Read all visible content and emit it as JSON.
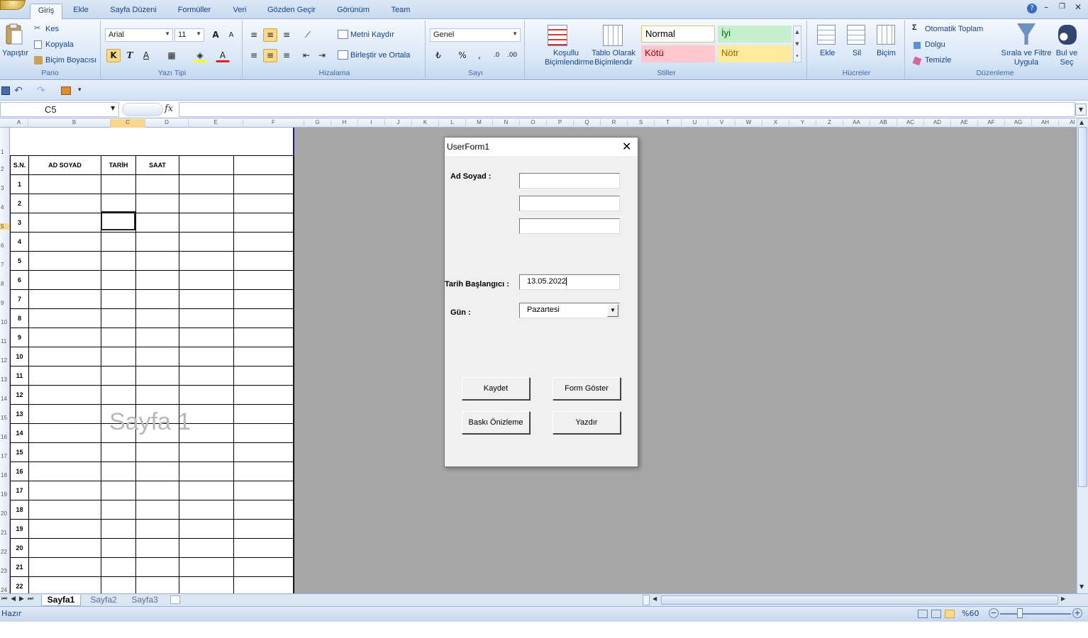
{
  "tabs": [
    "Giriş",
    "Ekle",
    "Sayfa Düzeni",
    "Formüller",
    "Veri",
    "Gözden Geçir",
    "Görünüm",
    "Team"
  ],
  "ribbon": {
    "pano": {
      "paste": "Yapıştır",
      "cut": "Kes",
      "copy": "Kopyala",
      "format_painter": "Biçim Boyacısı",
      "label": "Pano"
    },
    "font": {
      "name": "Arial",
      "size": "11",
      "bold": "K",
      "italic": "T",
      "underline": "A",
      "label": "Yazı Tipi"
    },
    "align": {
      "wrap": "Metni Kaydır",
      "merge": "Birleştir ve Ortala",
      "label": "Hizalama"
    },
    "number": {
      "format": "Genel",
      "percent": "%",
      "comma": ",",
      "label": "Sayı"
    },
    "styles": {
      "conditional": "Koşullu Biçimlendirme",
      "table": "Tablo Olarak Biçimlendir",
      "normal": "Normal",
      "good": "İyi",
      "bad": "Kötü",
      "neutral": "Nötr",
      "label": "Stiller"
    },
    "cells": {
      "insert": "Ekle",
      "delete": "Sil",
      "format": "Biçim",
      "label": "Hücreler"
    },
    "editing": {
      "autosum": "Otomatik Toplam",
      "fill": "Dolgu",
      "clear": "Temizle",
      "sort": "Sırala ve Filtre Uygula",
      "find": "Bul ve Seç",
      "label": "Düzenleme"
    }
  },
  "formula": {
    "name_box": "C5",
    "fx": "fx"
  },
  "columns": [
    "A",
    "B",
    "C",
    "D",
    "E",
    "F",
    "G",
    "H",
    "I",
    "J",
    "K",
    "L",
    "M",
    "N",
    "O",
    "P",
    "Q",
    "R",
    "S",
    "T",
    "U",
    "V",
    "W",
    "X",
    "Y",
    "Z",
    "AA",
    "AB",
    "AC",
    "AD",
    "AE",
    "AF",
    "AG",
    "AH",
    "AI"
  ],
  "rows": [
    "1",
    "2",
    "3",
    "4",
    "5",
    "6",
    "7",
    "8",
    "9",
    "10",
    "11",
    "12",
    "13",
    "14",
    "15",
    "16",
    "17",
    "18",
    "19",
    "20",
    "21",
    "22",
    "23",
    "24"
  ],
  "sheet": {
    "headers": [
      "S.N.",
      "AD SOYAD",
      "TARİH",
      "SAAT",
      "",
      ""
    ],
    "numbers": [
      "1",
      "2",
      "3",
      "4",
      "5",
      "6",
      "7",
      "8",
      "9",
      "10",
      "11",
      "12",
      "13",
      "14",
      "15",
      "16",
      "17",
      "18",
      "19",
      "20",
      "21",
      "22"
    ],
    "watermark": "Sayfa 1"
  },
  "sheet_tabs": [
    "Sayfa1",
    "Sayfa2",
    "Sayfa3"
  ],
  "status": {
    "ready": "Hazır",
    "zoom": "%60"
  },
  "form": {
    "title": "UserForm1",
    "ad_soyad_label": "Ad Soyad :",
    "tarih_label": "Tarih Başlangıcı :",
    "tarih_value": "13.05.2022",
    "gun_label": "Gün :",
    "gun_value": "Pazartesi",
    "kaydet": "Kaydet",
    "form_goster": "Form Göster",
    "baski": "Baskı Önizleme",
    "yazdir": "Yazdır"
  },
  "colors": {
    "accent": "#15428b",
    "ribbon": "#d8e6f7",
    "page_border": "#1a1a8a",
    "background": "#a6a6a6"
  }
}
